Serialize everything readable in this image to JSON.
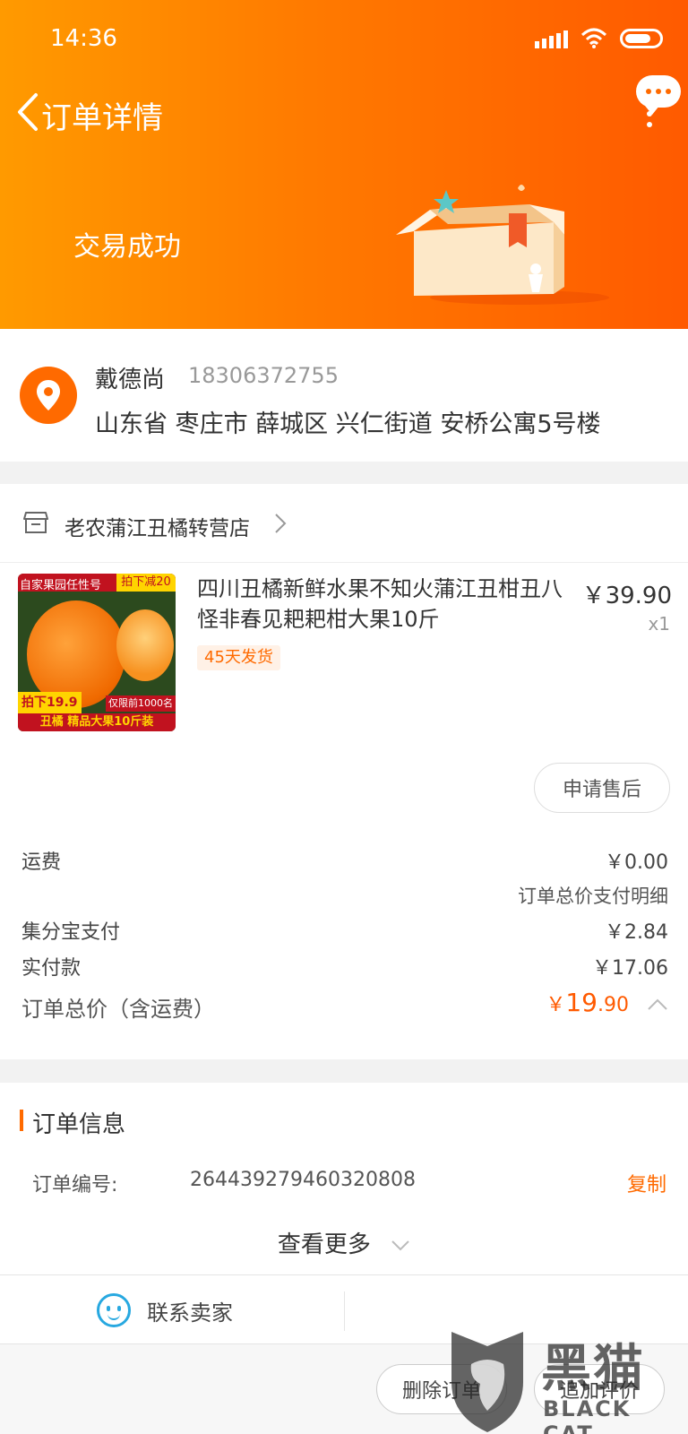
{
  "status_bar": {
    "time": "14:36"
  },
  "nav": {
    "title": "订单详情"
  },
  "header": {
    "trade_status": "交易成功"
  },
  "address": {
    "name": "戴德尚",
    "phone": "18306372755",
    "full": "山东省 枣庄市 薛城区 兴仁街道 安桥公寓5号楼"
  },
  "shop": {
    "name": "老农蒲江丑橘转营店"
  },
  "product": {
    "title": "四川丑橘新鲜水果不知火蒲江丑柑丑八怪非春见耙耙柑大果10斤",
    "price": "￥39.90",
    "qty": "x1",
    "ship_tag": "45天发货",
    "image_text": {
      "top_left": "自家果园任性号",
      "top_right": "拍下减20",
      "price_badge": "拍下19.9",
      "limit_badge": "仅限前1000名",
      "tagline": "丑橘 精品大果10斤装"
    }
  },
  "after_sale_label": "申请售后",
  "fees": {
    "shipping_label": "运费",
    "shipping_value": "￥0.00",
    "detail_link": "订单总价支付明细",
    "jifenbao_label": "集分宝支付",
    "jifenbao_value": "￥2.84",
    "paid_label": "实付款",
    "paid_value": "￥17.06",
    "total_label": "订单总价（含运费）",
    "total_symbol": "￥",
    "total_int": "19",
    "total_dec": ".90"
  },
  "order_info": {
    "title": "订单信息",
    "order_no_label": "订单编号:",
    "order_no_value": "264439279460320808",
    "copy_label": "复制",
    "see_more": "查看更多"
  },
  "contact": {
    "label": "联系卖家"
  },
  "actions": {
    "delete_label": "删除订单",
    "review_label": "追加评价"
  },
  "watermark": {
    "cn": "黑猫",
    "en": "BLACK CAT"
  },
  "colors": {
    "accent": "#ff6a00",
    "header_start": "#ff9a00",
    "header_end": "#ff5a00",
    "contact_blue": "#27a8e0"
  }
}
